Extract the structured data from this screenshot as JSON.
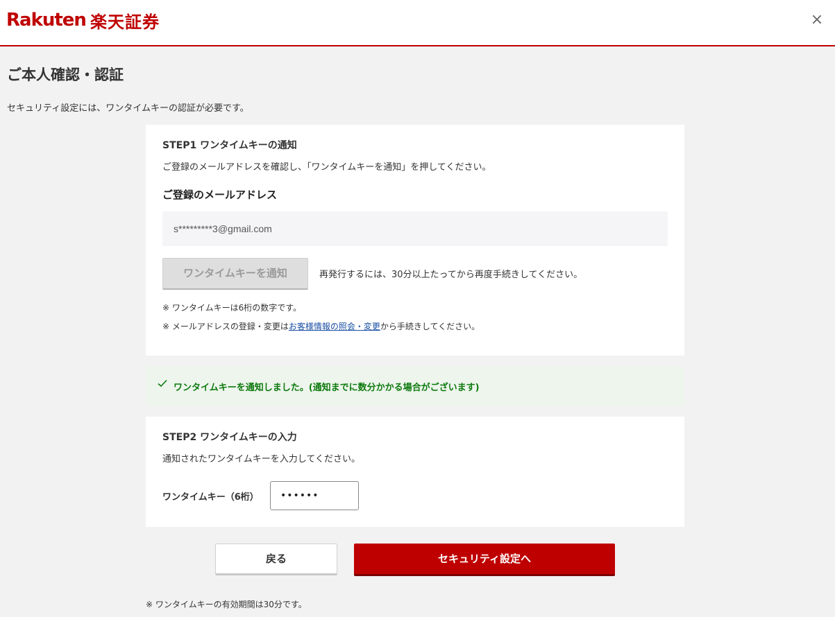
{
  "header": {
    "logo_text": "Rakuten",
    "logo_jp": "楽天証券",
    "close_label": "×"
  },
  "page": {
    "title": "ご本人確認・認証",
    "description": "セキュリティ設定には、ワンタイムキーの認証が必要です。"
  },
  "step1": {
    "title": "STEP1 ワンタイムキーの通知",
    "description": "ご登録のメールアドレスを確認し、「ワンタイムキーを通知」を押してください。",
    "email_label": "ご登録のメールアドレス",
    "email_value": "s*********3@gmail.com",
    "notify_button": "ワンタイムキーを通知",
    "reissue_note": "再発行するには、30分以上たってから再度手続きしてください。",
    "note1": "※ ワンタイムキーは6桁の数字です。",
    "note2_prefix": "※ メールアドレスの登録・変更は",
    "note2_link": "お客様情報の照会・変更",
    "note2_suffix": "から手続きしてください。"
  },
  "banner": {
    "message": "ワンタイムキーを通知しました。(通知までに数分かかる場合がございます)"
  },
  "step2": {
    "title": "STEP2 ワンタイムキーの入力",
    "description": "通知されたワンタイムキーを入力してください。",
    "key_label": "ワンタイムキー（6桁）",
    "key_value": "••••••"
  },
  "actions": {
    "back_button": "戻る",
    "primary_button": "セキュリティ設定へ"
  },
  "footer": {
    "note": "※ ワンタイムキーの有効期間は30分です。"
  },
  "colors": {
    "brand": "#bf0000",
    "success": "#0e7a0e",
    "link": "#1a4fa3"
  }
}
